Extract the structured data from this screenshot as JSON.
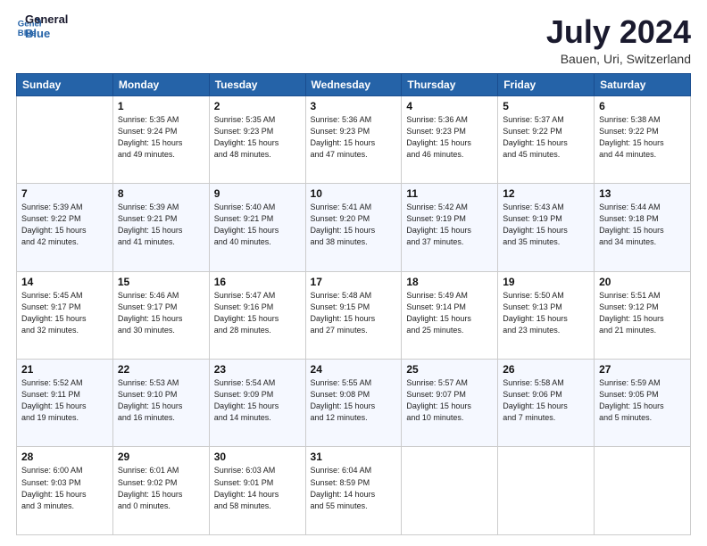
{
  "header": {
    "logo_line1": "General",
    "logo_line2": "Blue",
    "title": "July 2024",
    "subtitle": "Bauen, Uri, Switzerland"
  },
  "weekdays": [
    "Sunday",
    "Monday",
    "Tuesday",
    "Wednesday",
    "Thursday",
    "Friday",
    "Saturday"
  ],
  "weeks": [
    [
      {
        "day": "",
        "info": ""
      },
      {
        "day": "1",
        "info": "Sunrise: 5:35 AM\nSunset: 9:24 PM\nDaylight: 15 hours\nand 49 minutes."
      },
      {
        "day": "2",
        "info": "Sunrise: 5:35 AM\nSunset: 9:23 PM\nDaylight: 15 hours\nand 48 minutes."
      },
      {
        "day": "3",
        "info": "Sunrise: 5:36 AM\nSunset: 9:23 PM\nDaylight: 15 hours\nand 47 minutes."
      },
      {
        "day": "4",
        "info": "Sunrise: 5:36 AM\nSunset: 9:23 PM\nDaylight: 15 hours\nand 46 minutes."
      },
      {
        "day": "5",
        "info": "Sunrise: 5:37 AM\nSunset: 9:22 PM\nDaylight: 15 hours\nand 45 minutes."
      },
      {
        "day": "6",
        "info": "Sunrise: 5:38 AM\nSunset: 9:22 PM\nDaylight: 15 hours\nand 44 minutes."
      }
    ],
    [
      {
        "day": "7",
        "info": "Sunrise: 5:39 AM\nSunset: 9:22 PM\nDaylight: 15 hours\nand 42 minutes."
      },
      {
        "day": "8",
        "info": "Sunrise: 5:39 AM\nSunset: 9:21 PM\nDaylight: 15 hours\nand 41 minutes."
      },
      {
        "day": "9",
        "info": "Sunrise: 5:40 AM\nSunset: 9:21 PM\nDaylight: 15 hours\nand 40 minutes."
      },
      {
        "day": "10",
        "info": "Sunrise: 5:41 AM\nSunset: 9:20 PM\nDaylight: 15 hours\nand 38 minutes."
      },
      {
        "day": "11",
        "info": "Sunrise: 5:42 AM\nSunset: 9:19 PM\nDaylight: 15 hours\nand 37 minutes."
      },
      {
        "day": "12",
        "info": "Sunrise: 5:43 AM\nSunset: 9:19 PM\nDaylight: 15 hours\nand 35 minutes."
      },
      {
        "day": "13",
        "info": "Sunrise: 5:44 AM\nSunset: 9:18 PM\nDaylight: 15 hours\nand 34 minutes."
      }
    ],
    [
      {
        "day": "14",
        "info": "Sunrise: 5:45 AM\nSunset: 9:17 PM\nDaylight: 15 hours\nand 32 minutes."
      },
      {
        "day": "15",
        "info": "Sunrise: 5:46 AM\nSunset: 9:17 PM\nDaylight: 15 hours\nand 30 minutes."
      },
      {
        "day": "16",
        "info": "Sunrise: 5:47 AM\nSunset: 9:16 PM\nDaylight: 15 hours\nand 28 minutes."
      },
      {
        "day": "17",
        "info": "Sunrise: 5:48 AM\nSunset: 9:15 PM\nDaylight: 15 hours\nand 27 minutes."
      },
      {
        "day": "18",
        "info": "Sunrise: 5:49 AM\nSunset: 9:14 PM\nDaylight: 15 hours\nand 25 minutes."
      },
      {
        "day": "19",
        "info": "Sunrise: 5:50 AM\nSunset: 9:13 PM\nDaylight: 15 hours\nand 23 minutes."
      },
      {
        "day": "20",
        "info": "Sunrise: 5:51 AM\nSunset: 9:12 PM\nDaylight: 15 hours\nand 21 minutes."
      }
    ],
    [
      {
        "day": "21",
        "info": "Sunrise: 5:52 AM\nSunset: 9:11 PM\nDaylight: 15 hours\nand 19 minutes."
      },
      {
        "day": "22",
        "info": "Sunrise: 5:53 AM\nSunset: 9:10 PM\nDaylight: 15 hours\nand 16 minutes."
      },
      {
        "day": "23",
        "info": "Sunrise: 5:54 AM\nSunset: 9:09 PM\nDaylight: 15 hours\nand 14 minutes."
      },
      {
        "day": "24",
        "info": "Sunrise: 5:55 AM\nSunset: 9:08 PM\nDaylight: 15 hours\nand 12 minutes."
      },
      {
        "day": "25",
        "info": "Sunrise: 5:57 AM\nSunset: 9:07 PM\nDaylight: 15 hours\nand 10 minutes."
      },
      {
        "day": "26",
        "info": "Sunrise: 5:58 AM\nSunset: 9:06 PM\nDaylight: 15 hours\nand 7 minutes."
      },
      {
        "day": "27",
        "info": "Sunrise: 5:59 AM\nSunset: 9:05 PM\nDaylight: 15 hours\nand 5 minutes."
      }
    ],
    [
      {
        "day": "28",
        "info": "Sunrise: 6:00 AM\nSunset: 9:03 PM\nDaylight: 15 hours\nand 3 minutes."
      },
      {
        "day": "29",
        "info": "Sunrise: 6:01 AM\nSunset: 9:02 PM\nDaylight: 15 hours\nand 0 minutes."
      },
      {
        "day": "30",
        "info": "Sunrise: 6:03 AM\nSunset: 9:01 PM\nDaylight: 14 hours\nand 58 minutes."
      },
      {
        "day": "31",
        "info": "Sunrise: 6:04 AM\nSunset: 8:59 PM\nDaylight: 14 hours\nand 55 minutes."
      },
      {
        "day": "",
        "info": ""
      },
      {
        "day": "",
        "info": ""
      },
      {
        "day": "",
        "info": ""
      }
    ]
  ]
}
